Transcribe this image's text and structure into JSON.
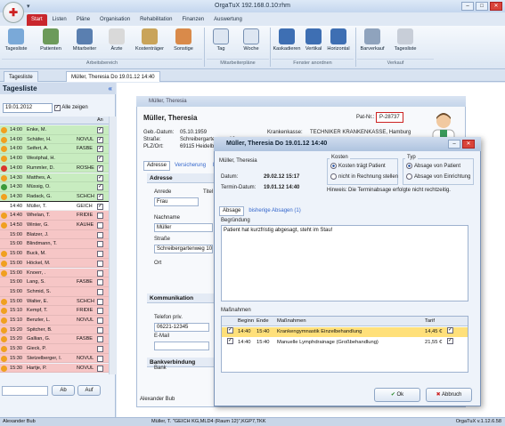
{
  "app": {
    "title": "OrgaTuX 192.168.0.10:rhm",
    "quick_access": "▾"
  },
  "menu_tabs": [
    "Start",
    "Listen",
    "Pläne",
    "Organisation",
    "Rehabilitation",
    "Finanzen",
    "Auswertung"
  ],
  "ribbon": {
    "buttons": [
      "Tagesliste",
      "Patienten",
      "Mitarbeiter",
      "Ärzte",
      "Kostenträger",
      "Sonstige",
      "Tag",
      "Woche",
      "Kaskadieren",
      "Vertikal",
      "Horizontal",
      "Barverkauf",
      "Tagesliste"
    ],
    "groups": [
      "Arbeitsbereich",
      "Mitarbeiterpläne",
      "Fenster anordnen",
      "Verkauf"
    ]
  },
  "doc_tabs": [
    "Tagesliste",
    "Müller, Theresia  Do 19.01.12 14:40"
  ],
  "sidebar": {
    "title": "Tagesliste",
    "collapse": "«",
    "date": "19.01.2012",
    "show_all": "Alle zeigen",
    "col_an": "An",
    "rows": [
      {
        "time": "14:00",
        "name": "Enke, M.",
        "code": "",
        "color": "#c8ecc0",
        "dot": "#f0a020",
        "check": true
      },
      {
        "time": "14:00",
        "name": "Schäfer, H.",
        "code": "NOVUL",
        "color": "#c8ecc0",
        "dot": "#f0a020",
        "check": true
      },
      {
        "time": "14:00",
        "name": "Seifert, A.",
        "code": "FASBE",
        "color": "#c8ecc0",
        "dot": "#f0a020",
        "check": true
      },
      {
        "time": "14:00",
        "name": "Westphal, H.",
        "code": "",
        "color": "#c8ecc0",
        "dot": "#f0a020",
        "check": true
      },
      {
        "time": "14:00",
        "name": "Rummler, D.",
        "code": "ROSHE",
        "color": "#c8ecc0",
        "dot": "#d9362b",
        "check": true
      },
      {
        "time": "14:30",
        "name": "Matthes, A.",
        "code": "",
        "color": "#c8ecc0",
        "dot": "#f0a020",
        "check": true
      },
      {
        "time": "14:30",
        "name": "Müssig, O.",
        "code": "",
        "color": "#c8ecc0",
        "dot": "#3a9a3a",
        "check": true
      },
      {
        "time": "14:30",
        "name": "Radack, G.",
        "code": "SCHCH",
        "color": "#c8ecc0",
        "dot": "#f0a020",
        "check": true
      },
      {
        "time": "14:40",
        "name": "Müller, T.",
        "code": "GEICH",
        "color": "#ffffff",
        "dot": "",
        "check": true
      },
      {
        "time": "14:40",
        "name": "Whelan, T.",
        "code": "FRIDIE",
        "color": "#f6c6c6",
        "dot": "#f0a020",
        "check": false
      },
      {
        "time": "14:50",
        "name": "Winter, G.",
        "code": "KAUHE",
        "color": "#f6c6c6",
        "dot": "#f0a020",
        "check": false
      },
      {
        "time": "15:00",
        "name": "Blatzer, J.",
        "code": "",
        "color": "#f6c6c6",
        "dot": "",
        "check": false
      },
      {
        "time": "15:00",
        "name": "Blindmann, T.",
        "code": "",
        "color": "#f6c6c6",
        "dot": "",
        "check": false
      },
      {
        "time": "15:00",
        "name": "Buck, M.",
        "code": "",
        "color": "#f6c6c6",
        "dot": "#f0a020",
        "check": false
      },
      {
        "time": "15:00",
        "name": "Höckel, M.",
        "code": "",
        "color": "#f6c6c6",
        "dot": "#f0a020",
        "check": false
      },
      {
        "time": "15:00",
        "name": "Knoerr, .",
        "code": "",
        "color": "#f6c6c6",
        "dot": "#f0a020",
        "check": false
      },
      {
        "time": "15:00",
        "name": "Lang, S.",
        "code": "FASBE",
        "color": "#f6c6c6",
        "dot": "",
        "check": false
      },
      {
        "time": "15:00",
        "name": "Schmid, S.",
        "code": "",
        "color": "#f6c6c6",
        "dot": "",
        "check": false
      },
      {
        "time": "15:00",
        "name": "Walter, E.",
        "code": "SCHCH",
        "color": "#f6c6c6",
        "dot": "#f0a020",
        "check": false
      },
      {
        "time": "15:10",
        "name": "Kempf, T.",
        "code": "FRIDIE",
        "color": "#f6c6c6",
        "dot": "#f0a020",
        "check": false
      },
      {
        "time": "15:10",
        "name": "Benzler, L.",
        "code": "NOVUL",
        "color": "#f6c6c6",
        "dot": "#f0a020",
        "check": false
      },
      {
        "time": "15:20",
        "name": "Spitcher, B.",
        "code": "",
        "color": "#f6c6c6",
        "dot": "#f0a020",
        "check": false
      },
      {
        "time": "15:20",
        "name": "Gallian, G.",
        "code": "FASBE",
        "color": "#f6c6c6",
        "dot": "#f0a020",
        "check": false
      },
      {
        "time": "15:30",
        "name": "Gieck, P.",
        "code": "",
        "color": "#f6c6c6",
        "dot": "#f0a020",
        "check": false
      },
      {
        "time": "15:30",
        "name": "Stetzelberger, I.",
        "code": "NOVUL",
        "color": "#f6c6c6",
        "dot": "#f0a020",
        "check": false
      },
      {
        "time": "15:30",
        "name": "Hartje, P.",
        "code": "NOVUL",
        "color": "#f6c6c6",
        "dot": "#f0a020",
        "check": false
      }
    ],
    "btn_ab": "Ab",
    "btn_auf": "Auf"
  },
  "patient": {
    "window_title": "Müller, Theresia",
    "name": "Müller, Theresia",
    "pat_nr_label": "Pat-Nr.:",
    "pat_nr": "P-28737",
    "geb_label": "Geb.-Datum:",
    "geb": "05.10.1959",
    "strasse_label": "Straße:",
    "strasse": "Schreibergartenweg 10",
    "plz_label": "PLZ/Ort:",
    "plz": "69115 Heidelb",
    "kasse_label": "Krankenkasse:",
    "kasse": "TECHNIKER KRANKENKASSE, Hamburg",
    "tabs": [
      "Adresse",
      "Versicherung",
      "Ka"
    ],
    "adresse_header": "Adresse",
    "anrede_label": "Anrede",
    "anrede": "Frau",
    "titel_label": "Titel",
    "nachname_label": "Nachname",
    "nachname": "Müller",
    "strasse2_label": "Straße",
    "strasse2": "Schreibergartenweg 10",
    "ort_label": "Ort",
    "kommunikation": "Kommunikation",
    "telefon_label": "Telefon priv.",
    "telefon": "06221-12345",
    "email_label": "E-Mail",
    "bank_header": "Bankverbindung",
    "bank_label": "Bank",
    "footer": "Alexander Bub"
  },
  "dialog": {
    "title": "Müller, Theresia  Do 19.01.12 14:40",
    "patient": "Müller, Theresia",
    "datum_label": "Datum:",
    "datum": "29.02.12 15:17",
    "termin_label": "Termin-Datum:",
    "termin": "19.01.12 14:40",
    "kosten_label": "Kosten",
    "kosten_opt1": "Kosten trägt Patient",
    "kosten_opt2": "nicht in Rechnung stellen",
    "typ_label": "Typ",
    "typ_opt1": "Absage von Patient",
    "typ_opt2": "Absage von Einrichtung",
    "hinweis_label": "Hinweis:",
    "hinweis": "Die Terminabsage erfolgte nicht rechtzeitig.",
    "tabs": [
      "Absage",
      "bisherige Absagen (1)"
    ],
    "begruendung_label": "Begründung",
    "begruendung": "Patient hat kurzfristig abgesagt, steht im Stau!",
    "massnahmen_label": "Maßnahmen",
    "table_headers": [
      "Beginn",
      "Ende",
      "Maßnahmen",
      "Tarif"
    ],
    "rows": [
      {
        "beginn": "14:40",
        "ende": "15:40",
        "massnahme": "Krankengymnastik Einzelbehandlung",
        "tarif": "14,45 €"
      },
      {
        "beginn": "14:40",
        "ende": "15:40",
        "massnahme": "Manuelle Lymphdrainage (Großbehandlung)",
        "tarif": "21,55 €"
      }
    ],
    "ok": "Ok",
    "abbruch": "Abbruch"
  },
  "status": {
    "left": "Alexander Bub",
    "center": "Müller, T. \"GEICH KG,MLD4 (Raum 12)\",KGP7,TKK",
    "right": "OrgaTuX v.1.12.6.58"
  },
  "colors": {
    "accent": "#c9262c",
    "highlight_row": "#ffe07a",
    "green_row": "#c8ecc0",
    "red_row": "#f6c6c6"
  }
}
